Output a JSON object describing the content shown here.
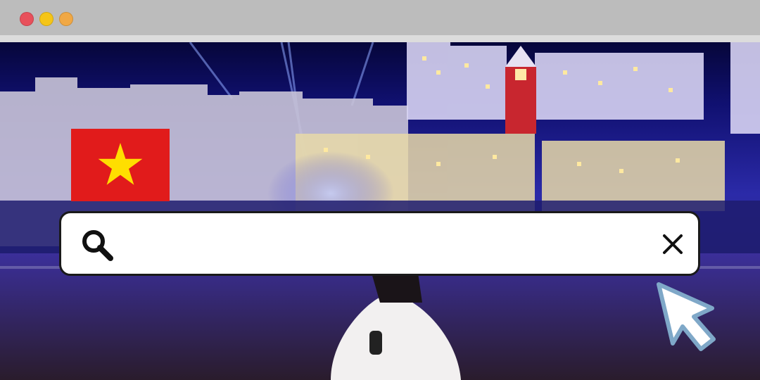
{
  "window": {
    "buttons": [
      {
        "name": "close",
        "color": "#e8505b"
      },
      {
        "name": "minimize",
        "color": "#f5c518"
      },
      {
        "name": "maximize",
        "color": "#f0a845"
      }
    ]
  },
  "flag": {
    "icon": "vietnam-flag-icon",
    "field_color": "#e11b1b",
    "star_color": "#ffde00"
  },
  "search": {
    "value": "",
    "placeholder": "",
    "search_icon": "search-icon",
    "clear_icon": "close-icon"
  },
  "pointer": {
    "icon": "mouse-cursor-icon",
    "fill": "#ffffff",
    "outline": "#7fa8c8"
  }
}
